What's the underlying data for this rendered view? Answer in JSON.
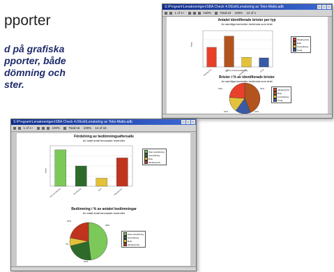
{
  "page": {
    "heading": "pporter",
    "tagline": [
      "d på grafiska",
      "pporter, både",
      "dömning och",
      "ster."
    ]
  },
  "window_back": {
    "title": "S:\\Program\\Lenatorentgen\\SBA Check 4.0\\Exit\\Lenatoring av Tekn-Matts.adb",
    "toolbar": [
      "1 of 1+",
      "100%",
      "Total:10",
      "100%",
      "12 of 1"
    ],
    "report1": {
      "title": "Antalet identifierade brister per typ",
      "subtitle": "Av samtliga kontroller bedömda som brist",
      "ylabel": "Antal",
      "xlabel": "Typ av brist/anmärkning"
    },
    "report2": {
      "title": "Brister i % av identifierade brister",
      "subtitle": "Av samtliga kontroller bedömda som brist"
    },
    "legend1": [
      "Allvarlig brist",
      "Brist",
      "Anmärkning",
      "Övrig"
    ],
    "legend2": [
      "Allvarlig brist",
      "Brist",
      "Anmärkning",
      "Övrig"
    ],
    "pie_labels": [
      "44%",
      "21%",
      "16%",
      "19%"
    ]
  },
  "window_front": {
    "title": "S:\\Program\\Lenatorentgen\\SBA Check 4.0\\Exit\\Lenatoring av Tekn-Matts.adb",
    "toolbar": [
      "1 of 1+",
      "100%",
      "Total:16",
      "100%",
      "14 of 16"
    ],
    "report1": {
      "title": "Fördelning av bedömningsaftersalle",
      "subtitle": "Av totalt antal bevanade kontroller",
      "ylabel": "Antal"
    },
    "report2": {
      "title": "Bedömning i % av antalet bedömningar",
      "subtitle": "Av totalt antal bevanade kontroller"
    },
    "legend1": [
      "Utan anmärkning",
      "Anmärkning",
      "Brist",
      "Allvarlig brist"
    ],
    "legend2": [
      "Utan anmärkning",
      "Anmärkning",
      "Brist",
      "Allvarlig brist"
    ],
    "pie_labels": [
      "48%",
      "23%",
      "7%",
      "22%"
    ]
  },
  "chart_data": [
    {
      "type": "bar",
      "categories": [
        "Allvarlig brist",
        "Brist",
        "Anmärkning",
        "Övrig"
      ],
      "values": [
        6.5,
        10.2,
        3.2,
        3.0
      ],
      "ylim": [
        0,
        12
      ],
      "colors": [
        "#e8402a",
        "#b3541e",
        "#e3c23a",
        "#3a5aa6"
      ]
    },
    {
      "type": "pie",
      "labels": [
        "Brist",
        "Övrig",
        "Anmärkning",
        "Allvarlig brist"
      ],
      "values": [
        44,
        16,
        16,
        24
      ],
      "colors": [
        "#b3541e",
        "#3a5aa6",
        "#e3c23a",
        "#e8402a"
      ]
    },
    {
      "type": "bar",
      "categories": [
        "Utan anmärkning",
        "Anmärkning",
        "Brist",
        "Allvarlig brist"
      ],
      "values": [
        9.0,
        5.0,
        2.0,
        7.0
      ],
      "ylim": [
        0,
        10
      ],
      "colors": [
        "#7cc95a",
        "#2e6b2a",
        "#e3c23a",
        "#c0341e"
      ]
    },
    {
      "type": "pie",
      "labels": [
        "Utan anmärkning",
        "Anmärkning",
        "Brist",
        "Allvarlig brist"
      ],
      "values": [
        48,
        23,
        7,
        22
      ],
      "colors": [
        "#7cc95a",
        "#2e6b2a",
        "#e3c23a",
        "#c0341e"
      ]
    }
  ]
}
